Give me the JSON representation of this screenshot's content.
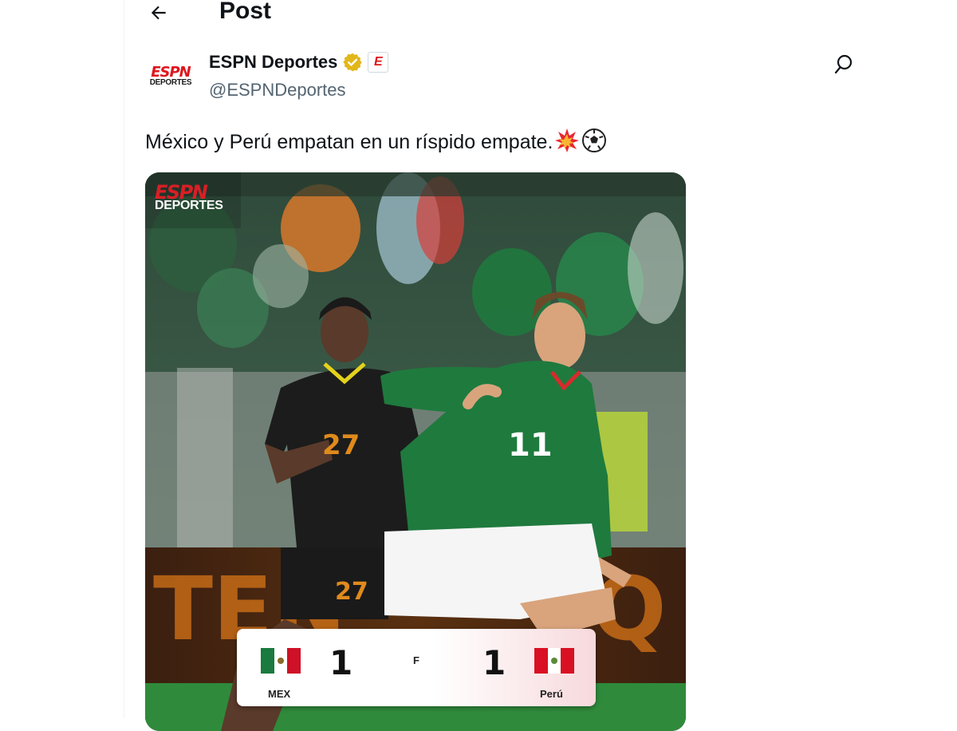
{
  "header": {
    "title": "Post",
    "back_icon": "arrow-left-icon"
  },
  "author": {
    "avatar_espn": "ESPN",
    "avatar_deportes": "DEPORTES",
    "name": "ESPN Deportes",
    "verified_badge": "gold-verified-badge",
    "affiliate_letter": "E",
    "handle": "@ESPNDeportes"
  },
  "tweet": {
    "text": "México y Perú empatan en un ríspido empate.",
    "emojis": [
      "collision-emoji",
      "soccer-ball-emoji"
    ]
  },
  "media": {
    "watermark_espn": "ESPN",
    "watermark_deportes": "DEPORTES",
    "scoreboard": {
      "home_team": "MEX",
      "home_score": "1",
      "status": "F",
      "away_score": "1",
      "away_team": "Perú"
    }
  },
  "colors": {
    "espn_red": "#e0161d",
    "verified_gold": "#e2b719",
    "mexico_green": "#1a7a3f",
    "handle_gray": "#536471"
  }
}
